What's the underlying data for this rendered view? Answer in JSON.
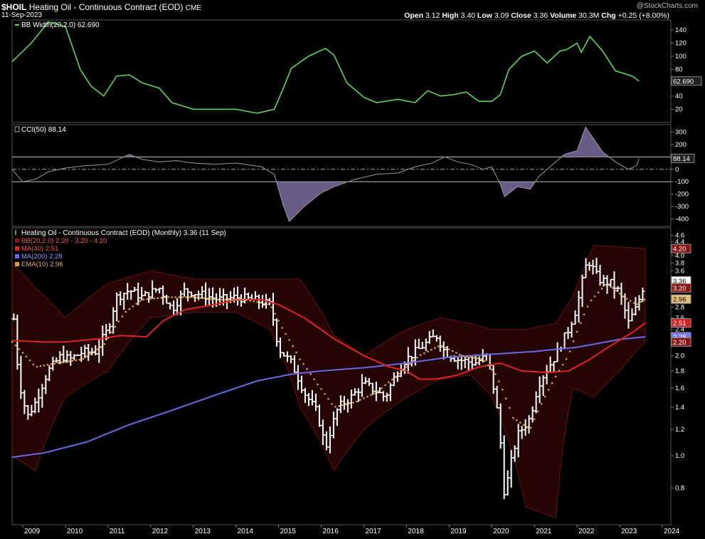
{
  "header": {
    "symbol": "$HOIL",
    "name": "Heating Oil - Continuous Contract (EOD)",
    "exchange": "CME",
    "date": "11-Sep-2023",
    "watermark": "@StockCharts.com",
    "quote": {
      "open_label": "Open",
      "open": "3.12",
      "high_label": "High",
      "high": "3.40",
      "low_label": "Low",
      "low": "3.09",
      "close_label": "Close",
      "close": "3.36",
      "volume_label": "Volume",
      "volume": "30.3M",
      "chg_label": "Chg",
      "chg": "+0.25 (+8.00%)"
    }
  },
  "colors": {
    "bbwidth": "#5bd65b",
    "cci": "#9a9a9a",
    "cci_fill": "#7a6b9c",
    "price": "#ffffff",
    "bb": "#8b1414",
    "ma40": "#e02222",
    "ma200": "#6a6ae6",
    "ema10": "#e0a040",
    "accent_box_cci": "#c0c0c0"
  },
  "chart_data": [
    {
      "type": "line",
      "panel": "BB Width",
      "legend": "BB Width(20,2.0) 62.690",
      "last_label": "62.690",
      "ylim": [
        0,
        155
      ],
      "yticks": [
        20,
        40,
        60,
        80,
        100,
        120,
        140
      ],
      "points": [
        [
          2008.75,
          92
        ],
        [
          2009.2,
          120
        ],
        [
          2009.6,
          152
        ],
        [
          2010.0,
          145
        ],
        [
          2010.35,
          80
        ],
        [
          2010.6,
          55
        ],
        [
          2010.9,
          40
        ],
        [
          2011.2,
          70
        ],
        [
          2011.5,
          72
        ],
        [
          2011.8,
          60
        ],
        [
          2012.2,
          52
        ],
        [
          2012.5,
          30
        ],
        [
          2013.0,
          20
        ],
        [
          2013.5,
          20
        ],
        [
          2014.0,
          20
        ],
        [
          2014.5,
          14
        ],
        [
          2014.9,
          20
        ],
        [
          2015.1,
          50
        ],
        [
          2015.3,
          82
        ],
        [
          2015.7,
          100
        ],
        [
          2016.1,
          112
        ],
        [
          2016.3,
          102
        ],
        [
          2016.6,
          60
        ],
        [
          2017.0,
          38
        ],
        [
          2017.3,
          30
        ],
        [
          2017.8,
          35
        ],
        [
          2018.2,
          30
        ],
        [
          2018.5,
          48
        ],
        [
          2018.8,
          40
        ],
        [
          2019.1,
          42
        ],
        [
          2019.4,
          46
        ],
        [
          2019.7,
          32
        ],
        [
          2020.0,
          32
        ],
        [
          2020.2,
          42
        ],
        [
          2020.4,
          80
        ],
        [
          2020.7,
          100
        ],
        [
          2021.0,
          108
        ],
        [
          2021.3,
          90
        ],
        [
          2021.6,
          108
        ],
        [
          2021.75,
          110
        ],
        [
          2022.0,
          120
        ],
        [
          2022.1,
          106
        ],
        [
          2022.3,
          130
        ],
        [
          2022.6,
          108
        ],
        [
          2022.9,
          78
        ],
        [
          2023.3,
          70
        ],
        [
          2023.45,
          62.69
        ]
      ]
    },
    {
      "type": "area",
      "panel": "CCI",
      "legend": "CCI(50) 88.14",
      "last_label": "88.14",
      "ylim": [
        -460,
        360
      ],
      "yticks": [
        -400,
        -300,
        -200,
        -100,
        0,
        100,
        200,
        300
      ],
      "bands": [
        100,
        -100
      ],
      "points": [
        [
          2008.75,
          0
        ],
        [
          2009.0,
          -100
        ],
        [
          2009.3,
          -80
        ],
        [
          2009.6,
          -20
        ],
        [
          2010.0,
          10
        ],
        [
          2010.5,
          30
        ],
        [
          2011.0,
          40
        ],
        [
          2011.5,
          120
        ],
        [
          2011.8,
          80
        ],
        [
          2012.2,
          60
        ],
        [
          2012.6,
          70
        ],
        [
          2013.0,
          50
        ],
        [
          2013.5,
          40
        ],
        [
          2014.0,
          50
        ],
        [
          2014.6,
          20
        ],
        [
          2014.9,
          -40
        ],
        [
          2015.1,
          -280
        ],
        [
          2015.25,
          -420
        ],
        [
          2015.6,
          -300
        ],
        [
          2016.0,
          -190
        ],
        [
          2016.3,
          -140
        ],
        [
          2016.8,
          -80
        ],
        [
          2017.3,
          -40
        ],
        [
          2017.8,
          -30
        ],
        [
          2018.2,
          20
        ],
        [
          2018.6,
          50
        ],
        [
          2018.9,
          100
        ],
        [
          2019.2,
          60
        ],
        [
          2019.5,
          40
        ],
        [
          2019.8,
          0
        ],
        [
          2020.0,
          20
        ],
        [
          2020.2,
          -120
        ],
        [
          2020.3,
          -220
        ],
        [
          2020.6,
          -140
        ],
        [
          2020.9,
          -160
        ],
        [
          2021.1,
          -60
        ],
        [
          2021.4,
          30
        ],
        [
          2021.7,
          120
        ],
        [
          2022.0,
          150
        ],
        [
          2022.2,
          340
        ],
        [
          2022.4,
          240
        ],
        [
          2022.6,
          140
        ],
        [
          2022.9,
          60
        ],
        [
          2023.2,
          0
        ],
        [
          2023.4,
          30
        ],
        [
          2023.45,
          88.14
        ]
      ]
    },
    {
      "type": "ohlc",
      "panel": "Price",
      "legend": "Heating Oil - Continuous Contract (EOD) (Monthly) 3.36 (11 Sep)",
      "scale": "log",
      "ylim": [
        0.62,
        4.85
      ],
      "yticks": [
        0.8,
        1.0,
        1.2,
        1.4,
        1.6,
        1.8,
        2.0,
        2.2,
        2.4,
        2.6,
        2.8,
        3.0,
        3.2,
        3.4,
        3.6,
        3.8,
        4.0,
        4.2,
        4.4,
        4.6
      ],
      "xlim": [
        2008.75,
        2024.2
      ],
      "xticks": [
        "2009",
        "2010",
        "2011",
        "2012",
        "2013",
        "2014",
        "2015",
        "2016",
        "2017",
        "2018",
        "2019",
        "2020",
        "2021",
        "2022",
        "2023",
        "2024"
      ],
      "price_path": [
        [
          2008.75,
          2.9
        ],
        [
          2008.9,
          1.7
        ],
        [
          2009.1,
          1.3
        ],
        [
          2009.3,
          1.45
        ],
        [
          2009.6,
          1.8
        ],
        [
          2009.9,
          2.0
        ],
        [
          2010.1,
          1.95
        ],
        [
          2010.4,
          2.05
        ],
        [
          2010.7,
          2.05
        ],
        [
          2011.0,
          2.4
        ],
        [
          2011.2,
          3.0
        ],
        [
          2011.5,
          3.15
        ],
        [
          2011.8,
          3.0
        ],
        [
          2012.2,
          3.2
        ],
        [
          2012.5,
          2.75
        ],
        [
          2012.8,
          3.15
        ],
        [
          2013.2,
          3.05
        ],
        [
          2013.6,
          2.95
        ],
        [
          2014.0,
          3.0
        ],
        [
          2014.4,
          2.95
        ],
        [
          2014.8,
          2.85
        ],
        [
          2015.0,
          2.1
        ],
        [
          2015.3,
          1.9
        ],
        [
          2015.6,
          1.55
        ],
        [
          2015.9,
          1.35
        ],
        [
          2016.1,
          1.05
        ],
        [
          2016.4,
          1.4
        ],
        [
          2016.7,
          1.5
        ],
        [
          2017.0,
          1.65
        ],
        [
          2017.5,
          1.5
        ],
        [
          2017.9,
          1.9
        ],
        [
          2018.3,
          2.1
        ],
        [
          2018.7,
          2.3
        ],
        [
          2018.9,
          2.05
        ],
        [
          2019.2,
          1.95
        ],
        [
          2019.6,
          1.9
        ],
        [
          2019.9,
          2.0
        ],
        [
          2020.15,
          1.3
        ],
        [
          2020.3,
          0.75
        ],
        [
          2020.6,
          1.15
        ],
        [
          2020.9,
          1.3
        ],
        [
          2021.1,
          1.65
        ],
        [
          2021.5,
          2.0
        ],
        [
          2021.8,
          2.4
        ],
        [
          2022.0,
          2.8
        ],
        [
          2022.25,
          3.9
        ],
        [
          2022.5,
          3.4
        ],
        [
          2022.8,
          3.3
        ],
        [
          2023.0,
          3.1
        ],
        [
          2023.2,
          2.5
        ],
        [
          2023.4,
          2.8
        ],
        [
          2023.6,
          3.36
        ]
      ],
      "series": [
        {
          "name": "BB(20,2.0) 2.20 - 3.20 - 4.20",
          "key": "bb_upper",
          "points": [
            [
              2008.75,
              3.8
            ],
            [
              2009.3,
              3.2
            ],
            [
              2010.0,
              2.6
            ],
            [
              2011.0,
              3.3
            ],
            [
              2012.0,
              3.6
            ],
            [
              2013.0,
              3.4
            ],
            [
              2014.0,
              3.4
            ],
            [
              2014.8,
              3.4
            ],
            [
              2015.5,
              3.4
            ],
            [
              2016.3,
              2.3
            ],
            [
              2017.0,
              2.0
            ],
            [
              2018.0,
              2.4
            ],
            [
              2018.8,
              2.6
            ],
            [
              2019.5,
              2.5
            ],
            [
              2020.0,
              2.4
            ],
            [
              2020.8,
              2.4
            ],
            [
              2021.5,
              2.5
            ],
            [
              2021.9,
              3.0
            ],
            [
              2022.4,
              4.3
            ],
            [
              2023.0,
              4.25
            ],
            [
              2023.6,
              4.2
            ]
          ]
        },
        {
          "name": "",
          "key": "bb_lower",
          "points": [
            [
              2008.75,
              1.0
            ],
            [
              2009.3,
              0.9
            ],
            [
              2010.0,
              1.5
            ],
            [
              2011.0,
              1.8
            ],
            [
              2012.0,
              2.6
            ],
            [
              2013.0,
              2.7
            ],
            [
              2014.0,
              2.7
            ],
            [
              2014.8,
              2.4
            ],
            [
              2015.5,
              1.4
            ],
            [
              2016.3,
              0.9
            ],
            [
              2017.0,
              1.2
            ],
            [
              2018.0,
              1.5
            ],
            [
              2018.8,
              1.7
            ],
            [
              2019.5,
              1.75
            ],
            [
              2020.0,
              1.5
            ],
            [
              2020.8,
              0.7
            ],
            [
              2021.5,
              0.65
            ],
            [
              2021.9,
              1.6
            ],
            [
              2022.4,
              1.5
            ],
            [
              2023.0,
              1.8
            ],
            [
              2023.6,
              2.2
            ]
          ]
        },
        {
          "name": "MA(40) 2.51",
          "key": "ma40",
          "points": [
            [
              2008.75,
              2.22
            ],
            [
              2009.5,
              2.2
            ],
            [
              2010.0,
              2.2
            ],
            [
              2010.8,
              2.25
            ],
            [
              2011.3,
              2.3
            ],
            [
              2011.9,
              2.28
            ],
            [
              2012.3,
              2.55
            ],
            [
              2012.8,
              2.75
            ],
            [
              2013.5,
              2.85
            ],
            [
              2014.0,
              2.95
            ],
            [
              2014.6,
              2.95
            ],
            [
              2015.0,
              2.85
            ],
            [
              2015.6,
              2.6
            ],
            [
              2016.3,
              2.25
            ],
            [
              2017.0,
              2.0
            ],
            [
              2017.6,
              1.85
            ],
            [
              2018.0,
              1.8
            ],
            [
              2018.3,
              1.7
            ],
            [
              2018.7,
              1.7
            ],
            [
              2019.2,
              1.75
            ],
            [
              2019.7,
              1.85
            ],
            [
              2020.2,
              1.9
            ],
            [
              2020.7,
              1.8
            ],
            [
              2021.3,
              1.78
            ],
            [
              2021.8,
              1.8
            ],
            [
              2022.3,
              1.95
            ],
            [
              2022.8,
              2.15
            ],
            [
              2023.3,
              2.35
            ],
            [
              2023.6,
              2.51
            ]
          ]
        },
        {
          "name": "MA(200) 2.28",
          "key": "ma200",
          "points": [
            [
              2008.75,
              0.99
            ],
            [
              2009.5,
              1.02
            ],
            [
              2010.5,
              1.1
            ],
            [
              2011.5,
              1.24
            ],
            [
              2012.5,
              1.37
            ],
            [
              2013.5,
              1.52
            ],
            [
              2014.5,
              1.68
            ],
            [
              2015.3,
              1.76
            ],
            [
              2016.0,
              1.8
            ],
            [
              2017.0,
              1.84
            ],
            [
              2018.0,
              1.9
            ],
            [
              2019.0,
              1.98
            ],
            [
              2020.0,
              2.02
            ],
            [
              2021.0,
              2.06
            ],
            [
              2022.0,
              2.12
            ],
            [
              2023.0,
              2.24
            ],
            [
              2023.6,
              2.28
            ]
          ]
        },
        {
          "name": "EMA(10) 2.96",
          "key": "ema10",
          "points": [
            [
              2008.75,
              2.2
            ],
            [
              2009.3,
              1.85
            ],
            [
              2009.8,
              1.9
            ],
            [
              2010.4,
              1.95
            ],
            [
              2010.9,
              2.15
            ],
            [
              2011.4,
              2.7
            ],
            [
              2011.8,
              2.95
            ],
            [
              2012.4,
              3.0
            ],
            [
              2013.0,
              3.0
            ],
            [
              2013.6,
              2.95
            ],
            [
              2014.2,
              2.95
            ],
            [
              2014.8,
              2.85
            ],
            [
              2015.1,
              2.4
            ],
            [
              2015.5,
              1.95
            ],
            [
              2015.9,
              1.65
            ],
            [
              2016.3,
              1.4
            ],
            [
              2016.8,
              1.45
            ],
            [
              2017.3,
              1.55
            ],
            [
              2017.8,
              1.75
            ],
            [
              2018.3,
              2.0
            ],
            [
              2018.8,
              2.15
            ],
            [
              2019.3,
              2.0
            ],
            [
              2019.8,
              1.95
            ],
            [
              2020.1,
              1.75
            ],
            [
              2020.5,
              1.3
            ],
            [
              2020.9,
              1.2
            ],
            [
              2021.3,
              1.55
            ],
            [
              2021.8,
              2.0
            ],
            [
              2022.3,
              2.9
            ],
            [
              2022.7,
              3.3
            ],
            [
              2023.1,
              3.0
            ],
            [
              2023.4,
              2.85
            ],
            [
              2023.6,
              2.96
            ]
          ]
        }
      ],
      "price_labels": [
        {
          "key": "price",
          "text": "3.36",
          "value": 3.36
        },
        {
          "key": "bb_upper",
          "text": "4.20",
          "value": 4.2
        },
        {
          "key": "bb_mid",
          "text": "3.20",
          "value": 3.2
        },
        {
          "key": "ema10",
          "text": "2.96",
          "value": 2.96
        },
        {
          "key": "ma40",
          "text": "2.51",
          "value": 2.51
        },
        {
          "key": "ma200",
          "text": "2.28",
          "value": 2.28
        },
        {
          "key": "bb_lower",
          "text": "2.20",
          "value": 2.2
        }
      ]
    }
  ]
}
